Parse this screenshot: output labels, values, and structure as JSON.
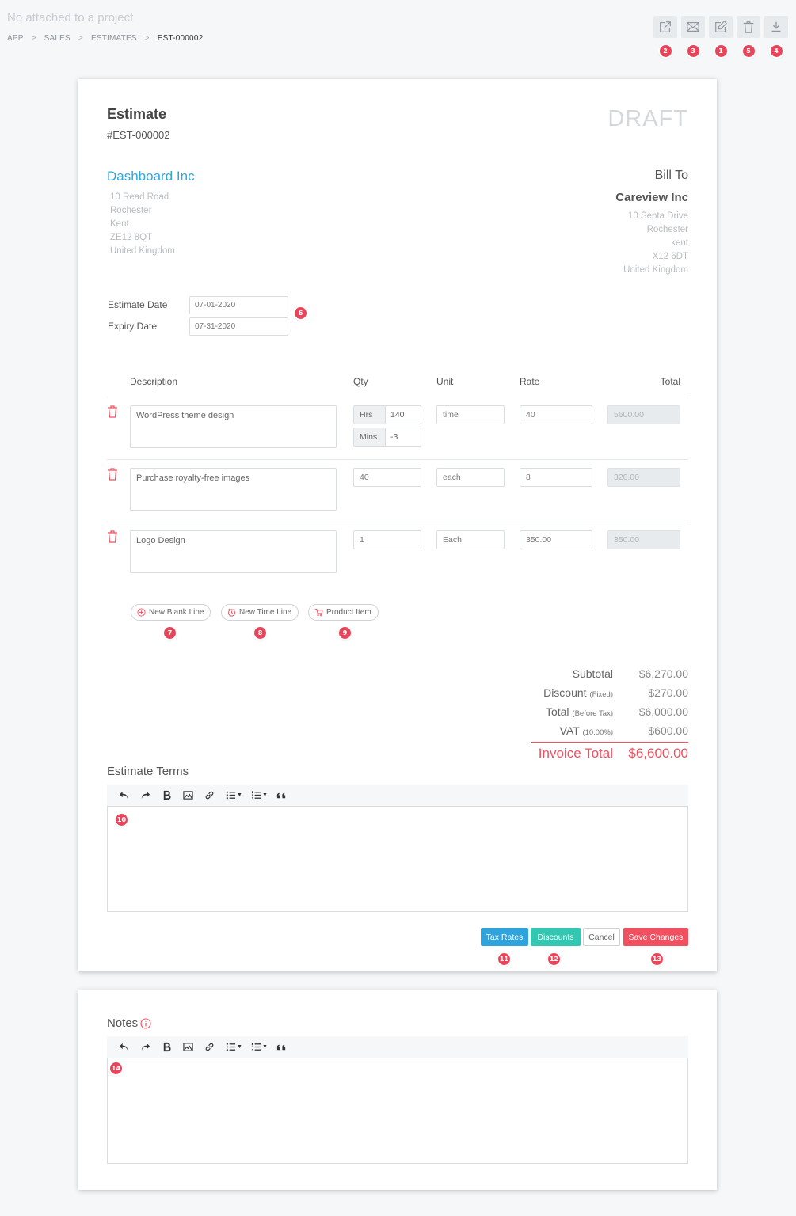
{
  "header": {
    "project_note": "No attached to a project",
    "breadcrumb": [
      "APP",
      "SALES",
      "ESTIMATES",
      "EST-000002"
    ],
    "toolbar": [
      {
        "icon": "share-icon",
        "marker": "2"
      },
      {
        "icon": "mail-icon",
        "marker": "3"
      },
      {
        "icon": "edit-icon",
        "marker": "1"
      },
      {
        "icon": "trash-icon",
        "marker": "5"
      },
      {
        "icon": "download-icon",
        "marker": "4"
      }
    ]
  },
  "estimate": {
    "title": "Estimate",
    "number": "#EST-000002",
    "status": "DRAFT",
    "from": {
      "company": "Dashboard Inc",
      "address": [
        "10 Read Road",
        "Rochester",
        "Kent",
        "ZE12 8QT",
        "United Kingdom"
      ]
    },
    "bill_to": {
      "label": "Bill To",
      "company": "Careview Inc",
      "address": [
        "10 Septa Drive",
        "Rochester",
        "kent",
        "X12 6DT",
        "United Kingdom"
      ]
    },
    "dates": {
      "estimate_label": "Estimate Date",
      "estimate_value": "07-01-2020",
      "expiry_label": "Expiry Date",
      "expiry_value": "07-31-2020",
      "marker": "6"
    }
  },
  "table": {
    "headers": {
      "description": "Description",
      "qty": "Qty",
      "unit": "Unit",
      "rate": "Rate",
      "total": "Total"
    },
    "rows": [
      {
        "description": "WordPress theme design",
        "hrs_label": "Hrs",
        "hrs": "140",
        "mins_label": "Mins",
        "mins": "-3",
        "unit": "time",
        "rate": "40",
        "total": "5600.00"
      },
      {
        "description": "Purchase royalty-free images",
        "qty": "40",
        "unit": "each",
        "rate": "8",
        "total": "320.00"
      },
      {
        "description": "Logo Design",
        "qty": "1",
        "unit": "Each",
        "rate": "350.00",
        "total": "350.00"
      }
    ]
  },
  "line_buttons": {
    "blank": "New Blank Line",
    "blank_marker": "7",
    "time": "New Time Line",
    "time_marker": "8",
    "product": "Product Item",
    "product_marker": "9"
  },
  "totals": {
    "subtotal_label": "Subtotal",
    "subtotal": "$6,270.00",
    "discount_label": "Discount",
    "discount_note": "(Fixed)",
    "discount": "$270.00",
    "total_label": "Total",
    "total_note": "(Before Tax)",
    "total": "$6,000.00",
    "vat_label": "VAT",
    "vat_note": "(10.00%)",
    "vat": "$600.00",
    "invoice_label": "Invoice Total",
    "invoice": "$6,600.00"
  },
  "terms": {
    "title": "Estimate Terms",
    "marker": "10"
  },
  "actions": {
    "tax": "Tax Rates",
    "tax_marker": "11",
    "discounts": "Discounts",
    "discounts_marker": "12",
    "cancel": "Cancel",
    "save": "Save Changes",
    "save_marker": "13"
  },
  "notes": {
    "title": "Notes",
    "marker": "14"
  },
  "colors": {
    "accent": "#2da8dc",
    "danger": "#f0505f",
    "teal": "#33c6b0",
    "marker": "#e8455a"
  }
}
